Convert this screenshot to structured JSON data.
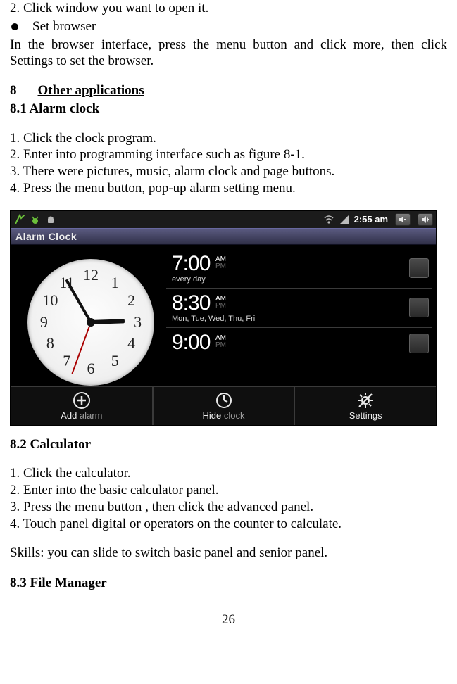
{
  "intro": {
    "line2": "2. Click window you want to open it.",
    "bullet_label": "Set browser",
    "browser_para": "In the browser interface, press the menu button and click more, then click Settings to set the browser."
  },
  "section8": {
    "num": "8",
    "title": "Other applications"
  },
  "section81": {
    "heading": "8.1 Alarm clock",
    "steps": [
      "1. Click the clock program.",
      "2. Enter into programming interface such as figure 8-1.",
      "3. There were pictures, music, alarm clock and page buttons.",
      "4. Press the menu button, pop-up alarm setting menu."
    ]
  },
  "device": {
    "status_time": "2:55 am",
    "app_title": "Alarm Clock",
    "clock_numbers": [
      "12",
      "1",
      "2",
      "3",
      "4",
      "5",
      "6",
      "7",
      "8",
      "9",
      "10",
      "11"
    ],
    "alarms": [
      {
        "time": "7:00",
        "am": true,
        "days": "every day"
      },
      {
        "time": "8:30",
        "am": true,
        "days": "Mon, Tue, Wed, Thu, Fri"
      },
      {
        "time": "9:00",
        "am": true,
        "days": ""
      }
    ],
    "actions": {
      "add_pre": "Add ",
      "add_post": "alarm",
      "hide_pre": "Hide ",
      "hide_post": "clock",
      "settings": "Settings"
    }
  },
  "section82": {
    "heading": "8.2 Calculator",
    "steps": [
      "1. Click the calculator.",
      "2. Enter into the basic calculator panel.",
      "3. Press the menu button , then click the advanced panel.",
      "4. Touch panel digital or operators on the counter to calculate."
    ],
    "skills": "Skills: you can slide to switch basic panel and senior panel."
  },
  "section83": {
    "heading": "8.3 File Manager"
  },
  "page_number": "26"
}
